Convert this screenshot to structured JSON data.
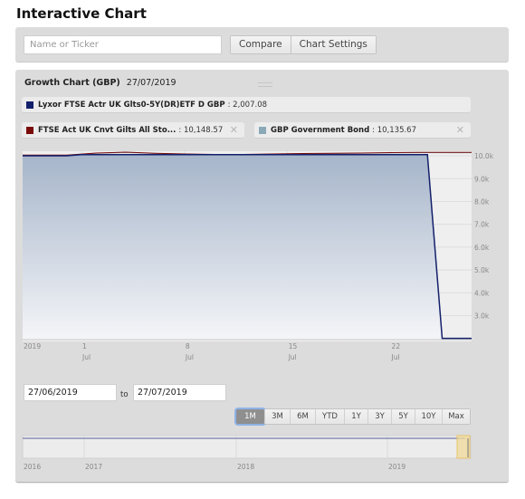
{
  "page": {
    "title": "Interactive Chart"
  },
  "search": {
    "placeholder": "Name or Ticker",
    "value": "",
    "compare_label": "Compare",
    "settings_label": "Chart Settings"
  },
  "chart_header": {
    "title": "Growth Chart (GBP)",
    "date": "27/07/2019"
  },
  "legend": [
    {
      "name": "Lyxor FTSE Actr UK Glts0-5Y(DR)ETF D GBP",
      "value": ": 2,007.08",
      "color": "#13206b",
      "removable": false
    },
    {
      "name": "FTSE Act UK Cnvt Gilts All Sto...",
      "value": ": 10,148.57",
      "color": "#7a0b0b",
      "removable": true
    },
    {
      "name": "GBP Government Bond",
      "value": ": 10,135.67",
      "color": "#8aa9b8",
      "removable": true
    }
  ],
  "close_glyph": "✕",
  "date_range": {
    "from": "27/06/2019",
    "to_label": "to",
    "to": "27/07/2019"
  },
  "range_buttons": [
    {
      "label": "1M",
      "active": true
    },
    {
      "label": "3M",
      "active": false
    },
    {
      "label": "6M",
      "active": false
    },
    {
      "label": "YTD",
      "active": false
    },
    {
      "label": "1Y",
      "active": false
    },
    {
      "label": "3Y",
      "active": false
    },
    {
      "label": "5Y",
      "active": false
    },
    {
      "label": "10Y",
      "active": false
    },
    {
      "label": "Max",
      "active": false
    }
  ],
  "chart_data": {
    "type": "area",
    "title": "Growth Chart (GBP)",
    "xlabel": "",
    "ylabel": "",
    "x_range": [
      "2019-06-27",
      "2019-07-27"
    ],
    "ylim": [
      2000,
      10200
    ],
    "y_ticks": [
      {
        "value": 3000,
        "label": "3.0k"
      },
      {
        "value": 4000,
        "label": "4.0k"
      },
      {
        "value": 5000,
        "label": "5.0k"
      },
      {
        "value": 6000,
        "label": "6.0k"
      },
      {
        "value": 7000,
        "label": "7.0k"
      },
      {
        "value": 8000,
        "label": "8.0k"
      },
      {
        "value": 9000,
        "label": "9.0k"
      },
      {
        "value": 10000,
        "label": "10.0k"
      }
    ],
    "x_ticks": [
      {
        "day": 0,
        "label": "2019",
        "sub": ""
      },
      {
        "day": 4,
        "label": "1",
        "sub": "Jul"
      },
      {
        "day": 11,
        "label": "8",
        "sub": "Jul"
      },
      {
        "day": 18,
        "label": "15",
        "sub": "Jul"
      },
      {
        "day": 25,
        "label": "22",
        "sub": "Jul"
      }
    ],
    "grid": true,
    "legend_position": "top",
    "series": [
      {
        "name": "Lyxor FTSE Actr UK Glts0-5Y(DR)ETF D GBP",
        "color": "#13206b",
        "fill": true,
        "x": [
          0,
          3,
          4,
          6,
          8,
          10,
          12,
          14,
          16,
          18,
          20,
          22,
          24,
          27.5,
          28.5,
          30.5
        ],
        "values": [
          10000,
          10000,
          10050,
          10050,
          10050,
          10050,
          10050,
          10050,
          10050,
          10050,
          10050,
          10050,
          10050,
          10050,
          2007,
          2007
        ]
      },
      {
        "name": "FTSE Act UK Cnvt Gilts All Sto...",
        "color": "#7a0b0b",
        "fill": false,
        "x": [
          0,
          3,
          5,
          7,
          9,
          11,
          13,
          15,
          17,
          19,
          21,
          23,
          25,
          27,
          29,
          30.5
        ],
        "values": [
          10030,
          10030,
          10120,
          10160,
          10110,
          10080,
          10060,
          10060,
          10080,
          10100,
          10110,
          10120,
          10140,
          10150,
          10148,
          10148
        ]
      },
      {
        "name": "GBP Government Bond",
        "color": "#8aa9b8",
        "fill": false,
        "x": [
          0,
          3,
          5,
          7,
          9,
          11,
          13,
          15,
          17,
          19,
          21,
          23,
          25,
          27,
          29,
          30.5
        ],
        "values": [
          10020,
          10020,
          10110,
          10150,
          10100,
          10070,
          10050,
          10050,
          10070,
          10090,
          10100,
          10110,
          10130,
          10140,
          10136,
          10136
        ]
      }
    ],
    "navigator": {
      "x_ticks": [
        "2016",
        "2017",
        "2018",
        "2019"
      ],
      "selection": [
        "27/06/2019",
        "27/07/2019"
      ],
      "selection_color": "#f2d99a"
    }
  }
}
